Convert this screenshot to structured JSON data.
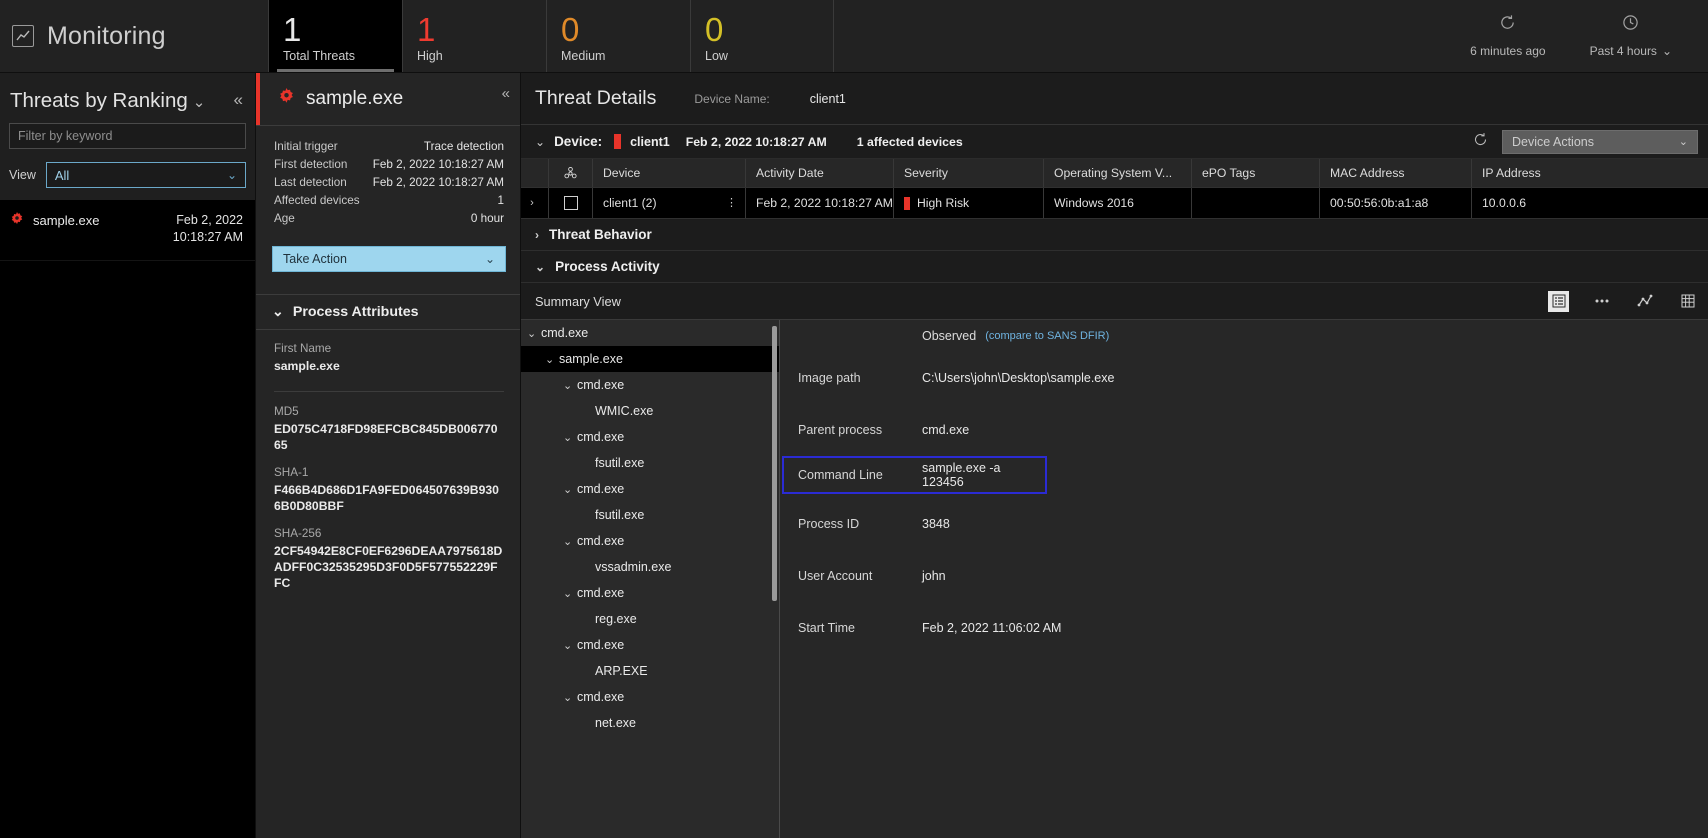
{
  "topbar": {
    "brand_icon": "chart-line-icon",
    "brand_title": "Monitoring",
    "kpis": [
      {
        "value": "1",
        "label": "Total Threats",
        "color": "#e8e8e8",
        "active": true
      },
      {
        "value": "1",
        "label": "High",
        "color": "#ef3b30",
        "active": false
      },
      {
        "value": "0",
        "label": "Medium",
        "color": "#e08a29",
        "active": false
      },
      {
        "value": "0",
        "label": "Low",
        "color": "#d4c027",
        "active": false
      }
    ],
    "refresh": {
      "icon": "refresh-icon",
      "label": "6 minutes ago"
    },
    "timerange": {
      "icon": "clock-icon",
      "label": "Past 4 hours",
      "caret": "⌄"
    }
  },
  "left_panel": {
    "title": "Threats by Ranking",
    "title_caret": "⌄",
    "collapse_icon": "«",
    "filter_placeholder": "Filter by keyword",
    "filter_value": "",
    "view_label": "View",
    "view_value": "All",
    "view_caret": "⌄",
    "threat": {
      "icon": "gear-icon",
      "name": "sample.exe",
      "date": "Feb 2, 2022",
      "time": "10:18:27 AM"
    }
  },
  "mid_panel": {
    "icon": "gear-icon",
    "title": "sample.exe",
    "collapse_icon": "«",
    "summary": [
      {
        "key": "Initial trigger",
        "value": "Trace detection"
      },
      {
        "key": "First detection",
        "value": "Feb 2, 2022 10:18:27 AM"
      },
      {
        "key": "Last detection",
        "value": "Feb 2, 2022 10:18:27 AM"
      },
      {
        "key": "Affected devices",
        "value": "1"
      },
      {
        "key": "Age",
        "value": "0 hour"
      }
    ],
    "take_action_label": "Take Action",
    "take_action_caret": "⌄",
    "attributes_section": {
      "caret": "⌄",
      "title": "Process Attributes",
      "items": [
        {
          "key": "First Name",
          "value": "sample.exe"
        },
        {
          "key": "MD5",
          "value": "ED075C4718FD98EFCBC845DB00677065"
        },
        {
          "key": "SHA-1",
          "value": "F466B4D686D1FA9FED064507639B9306B0D80BBF"
        },
        {
          "key": "SHA-256",
          "value": "2CF54942E8CF0EF6296DEAA7975618DADFF0C32535295D3F0D5F577552229FFC"
        }
      ]
    }
  },
  "details": {
    "title": "Threat Details",
    "device_name_label": "Device Name:",
    "device_name_value": "client1",
    "device_bar": {
      "caret": "⌄",
      "label": "Device:",
      "device": "client1",
      "date": "Feb 2, 2022 10:18:27 AM",
      "affected": "1 affected devices",
      "refresh_icon": "refresh-icon",
      "actions_label": "Device Actions",
      "actions_caret": "⌄"
    },
    "table": {
      "columns": [
        "",
        "biohazard-icon",
        "Device",
        "Activity Date",
        "Severity",
        "Operating System V...",
        "ePO Tags",
        "MAC Address",
        "IP Address"
      ],
      "rows": [
        {
          "device": "client1 (2)",
          "activity_date": "Feb 2, 2022 10:18:27 AM",
          "severity": "High Risk",
          "severity_color": "#e8342a",
          "os": "Windows 2016",
          "epo_tags": "",
          "mac": "00:50:56:0b:a1:a8",
          "ip": "10.0.0.6"
        }
      ]
    },
    "threat_behavior": {
      "caret": "›",
      "label": "Threat Behavior"
    },
    "process_activity": {
      "caret": "⌄",
      "label": "Process Activity"
    },
    "toolbar": {
      "summary_view": "Summary View",
      "icons": [
        "list-view-icon",
        "ellipsis-icon",
        "node-graph-icon",
        "grid-view-icon"
      ]
    },
    "tree": [
      {
        "label": "cmd.exe",
        "depth": 0,
        "caret": "⌄",
        "selected": false
      },
      {
        "label": "sample.exe",
        "depth": 1,
        "caret": "⌄",
        "selected": true
      },
      {
        "label": "cmd.exe",
        "depth": 2,
        "caret": "⌄",
        "selected": false
      },
      {
        "label": "WMIC.exe",
        "depth": 3,
        "caret": "",
        "selected": false
      },
      {
        "label": "cmd.exe",
        "depth": 2,
        "caret": "⌄",
        "selected": false
      },
      {
        "label": "fsutil.exe",
        "depth": 3,
        "caret": "",
        "selected": false
      },
      {
        "label": "cmd.exe",
        "depth": 2,
        "caret": "⌄",
        "selected": false
      },
      {
        "label": "fsutil.exe",
        "depth": 3,
        "caret": "",
        "selected": false
      },
      {
        "label": "cmd.exe",
        "depth": 2,
        "caret": "⌄",
        "selected": false
      },
      {
        "label": "vssadmin.exe",
        "depth": 3,
        "caret": "",
        "selected": false
      },
      {
        "label": "cmd.exe",
        "depth": 2,
        "caret": "⌄",
        "selected": false
      },
      {
        "label": "reg.exe",
        "depth": 3,
        "caret": "",
        "selected": false
      },
      {
        "label": "cmd.exe",
        "depth": 2,
        "caret": "⌄",
        "selected": false
      },
      {
        "label": "ARP.EXE",
        "depth": 3,
        "caret": "",
        "selected": false
      },
      {
        "label": "cmd.exe",
        "depth": 2,
        "caret": "⌄",
        "selected": false
      },
      {
        "label": "net.exe",
        "depth": 3,
        "caret": "",
        "selected": false
      }
    ],
    "observed": {
      "label": "Observed",
      "link": "(compare to SANS DFIR)"
    },
    "fields": [
      {
        "key": "Image path",
        "value": "C:\\Users\\john\\Desktop\\sample.exe",
        "highlight": false
      },
      {
        "key": "Parent process",
        "value": "cmd.exe",
        "highlight": false
      },
      {
        "key": "Command Line",
        "value": "sample.exe -a 123456",
        "highlight": true
      },
      {
        "key": "Process ID",
        "value": "3848",
        "highlight": false
      },
      {
        "key": "User Account",
        "value": "john",
        "highlight": false
      },
      {
        "key": "Start Time",
        "value": "Feb 2, 2022 11:06:02 AM",
        "highlight": false
      }
    ]
  }
}
